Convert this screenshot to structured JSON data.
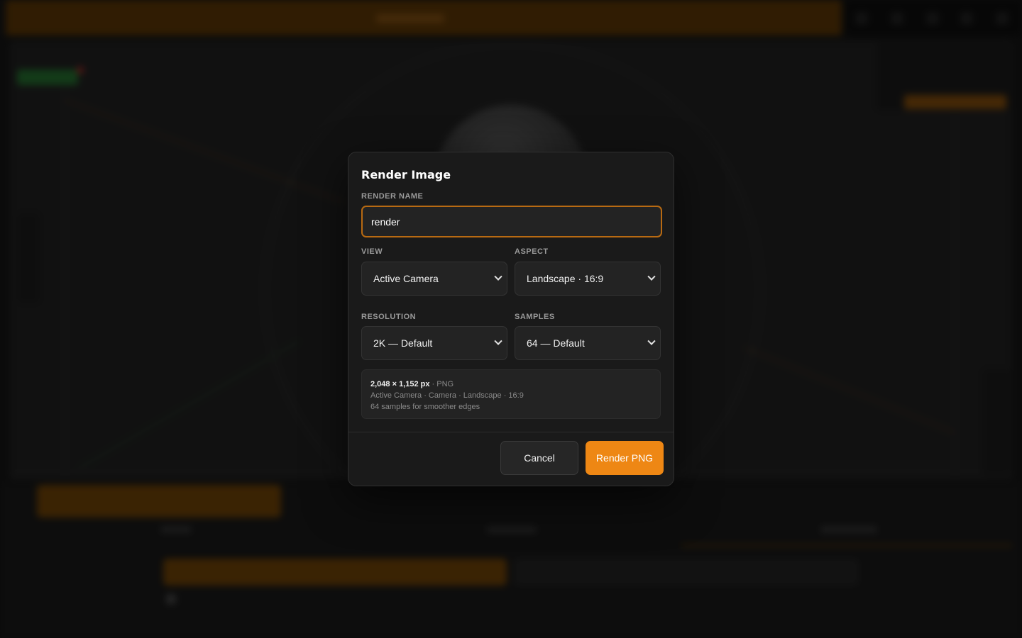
{
  "dialog": {
    "title": "Render Image",
    "render_name": {
      "label": "RENDER NAME",
      "value": "render"
    },
    "view": {
      "label": "VIEW",
      "selected": "Active Camera"
    },
    "aspect": {
      "label": "ASPECT",
      "selected": "Landscape · 16:9"
    },
    "resolution": {
      "label": "RESOLUTION",
      "selected": "2K — Default"
    },
    "samples": {
      "label": "SAMPLES",
      "selected": "64 — Default"
    },
    "summary": {
      "dimensions": "2,048 × 1,152 px",
      "format": " · PNG",
      "line2": "Active Camera · Camera · Landscape · 16:9",
      "line3": "64 samples for smoother edges"
    },
    "buttons": {
      "cancel": "Cancel",
      "render": "Render PNG"
    }
  },
  "colors": {
    "accent": "#ee8714",
    "input_focus_border": "#b86a12",
    "modal_bg": "#1a1a1a"
  },
  "icons": {
    "dropdown": "chevron-down-icon"
  }
}
